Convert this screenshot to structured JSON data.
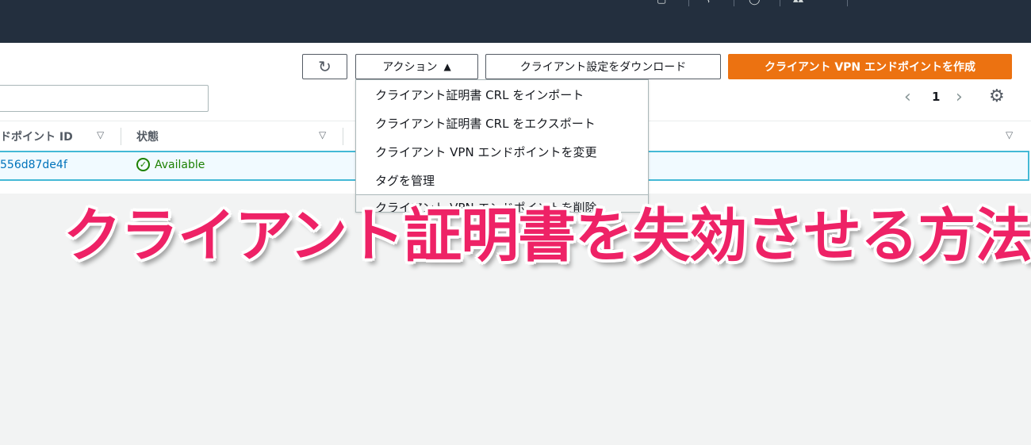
{
  "toolbar": {
    "refresh_icon": "↻",
    "actions_label": "アクション",
    "actions_caret": "▲",
    "download_label": "クライアント設定をダウンロード",
    "create_label": "クライアント VPN エンドポイントを作成"
  },
  "actions_menu": {
    "items": [
      "クライアント証明書 CRL をインポート",
      "クライアント証明書 CRL をエクスポート",
      "クライアント VPN エンドポイントを変更",
      "タグを管理"
    ],
    "partial_item": "クライアント VPN エンドポイントを削除"
  },
  "pagination": {
    "prev_icon": "‹",
    "current_page": "1",
    "next_icon": "›",
    "settings_icon": "⚙"
  },
  "table": {
    "columns": [
      "ドポイント ID",
      "状態"
    ],
    "sort_icon": "▽",
    "rows": [
      {
        "endpoint_id": "556d87de4f",
        "status": "Available",
        "status_icon": "✓"
      }
    ]
  },
  "caption": "クライアント証明書を失効させる方法",
  "colors": {
    "topbar": "#232f3e",
    "primary_button": "#ec7211",
    "link": "#0073bb",
    "status_ok": "#1d8102",
    "selected_row_border": "#44b9d6",
    "caption": "#ee2266"
  }
}
